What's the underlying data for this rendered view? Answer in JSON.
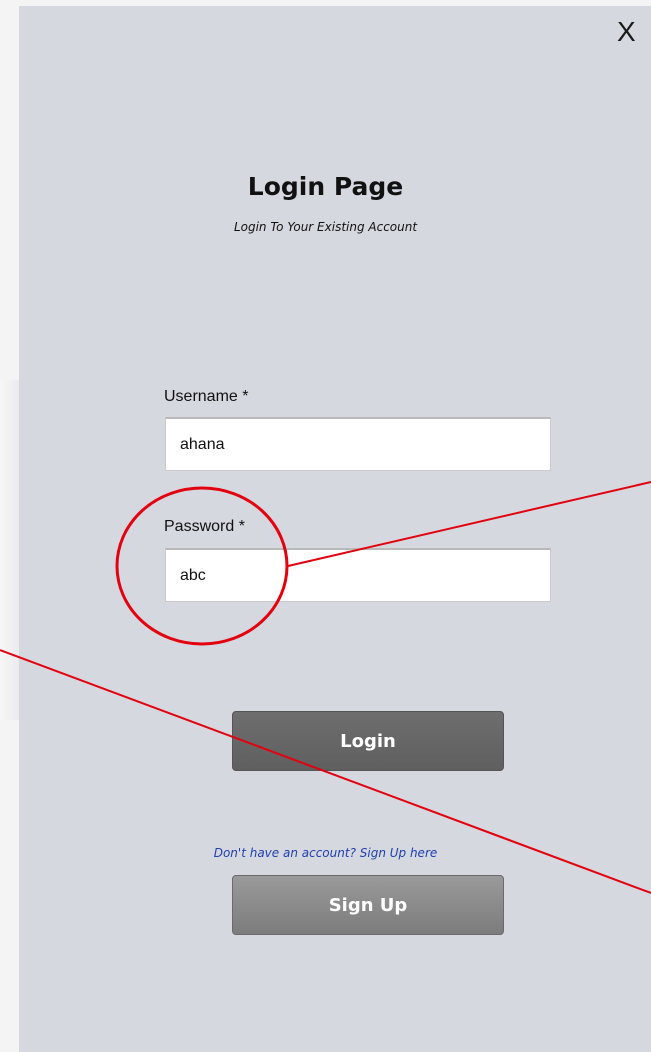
{
  "window": {
    "close_glyph": "X"
  },
  "page": {
    "title": "Login Page",
    "subtitle": "Login To Your Existing Account"
  },
  "form": {
    "username_label": "Username *",
    "username_value": "ahana",
    "password_label": "Password *",
    "password_value": "abc"
  },
  "buttons": {
    "login_label": "Login",
    "signup_label": "Sign Up"
  },
  "signup_prompt": "Don't have an account? Sign Up here",
  "colors": {
    "panel_bg": "#d6d8e0",
    "annotation_red": "#e3000f",
    "link_blue": "#1f3fae"
  }
}
